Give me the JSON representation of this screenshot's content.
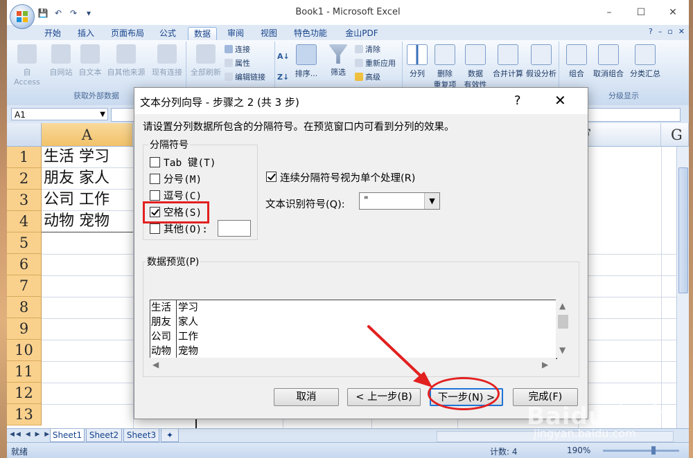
{
  "window": {
    "title": "Book1 - Microsoft Excel",
    "controls": [
      "–",
      "☐",
      "✕"
    ]
  },
  "qat": {
    "save": "💾",
    "undo": "↶",
    "redo": "↷",
    "customize": "▾"
  },
  "ribbon": {
    "tabs": [
      "开始",
      "插入",
      "页面布局",
      "公式",
      "数据",
      "审阅",
      "视图",
      "特色功能",
      "金山PDF"
    ],
    "active_tab": "数据",
    "help_icons": [
      "?",
      "–",
      "▫",
      "✕"
    ],
    "groups": {
      "external": {
        "label": "获取外部数据",
        "buttons": [
          "自 Access",
          "自网站",
          "自文本",
          "自其他来源",
          "现有连接"
        ]
      },
      "connections": {
        "refresh": "全部刷新",
        "items": [
          "连接",
          "属性",
          "编辑链接"
        ]
      },
      "sort": {
        "sort": "排序...",
        "filter": "筛选",
        "items": [
          "清除",
          "重新应用",
          "高级"
        ]
      },
      "tools": {
        "buttons": [
          "分列",
          "删除",
          "数据",
          "合并计算",
          "假设分析"
        ],
        "sublines": [
          "重复项",
          "有效性"
        ]
      },
      "outline": {
        "label": "分级显示",
        "buttons": [
          "组合",
          "取消组合",
          "分类汇总"
        ]
      }
    }
  },
  "formula_bar": {
    "name_box": "A1"
  },
  "grid": {
    "columns": [
      "A",
      "F",
      "G"
    ],
    "rows": [
      "1",
      "2",
      "3",
      "4",
      "5",
      "6",
      "7",
      "8",
      "9",
      "10",
      "11",
      "12",
      "13"
    ],
    "cells": [
      "生活 学习",
      "朋友 家人",
      "公司 工作",
      "动物 宠物"
    ]
  },
  "sheets": [
    "Sheet1",
    "Sheet2",
    "Sheet3"
  ],
  "status": {
    "ready": "就绪",
    "count": "计数: 4",
    "zoom": "190%"
  },
  "dialog": {
    "title": "文本分列向导 - 步骤之 2 (共 3 步)",
    "help": "?",
    "close": "✕",
    "description": "请设置分列数据所包含的分隔符号。在预览窗口内可看到分列的效果。",
    "delimiters_legend": "分隔符号",
    "delimiters": [
      {
        "label": "Tab 键(T)",
        "checked": false
      },
      {
        "label": "分号(M)",
        "checked": false
      },
      {
        "label": "逗号(C)",
        "checked": false
      },
      {
        "label": "空格(S)",
        "checked": true
      },
      {
        "label": "其他(O):",
        "checked": false
      }
    ],
    "consecutive_label": "连续分隔符号视为单个处理(R)",
    "consecutive_checked": true,
    "qualifier_label": "文本识别符号(Q):",
    "qualifier_value": "\"",
    "preview_legend": "数据预览(P)",
    "preview_rows": [
      [
        "生活",
        "学习"
      ],
      [
        "朋友",
        "家人"
      ],
      [
        "公司",
        "工作"
      ],
      [
        "动物",
        "宠物"
      ]
    ],
    "buttons": {
      "cancel": "取消",
      "back": "< 上一步(B)",
      "next": "下一步(N) >",
      "finish": "完成(F)"
    }
  },
  "watermark": {
    "brand": "Baidu 经验",
    "url": "jingyan.baidu.com"
  },
  "colors": {
    "highlight_red": "#e22020",
    "ribbon_blue": "#15428b",
    "row_header": "#f9d18d"
  }
}
